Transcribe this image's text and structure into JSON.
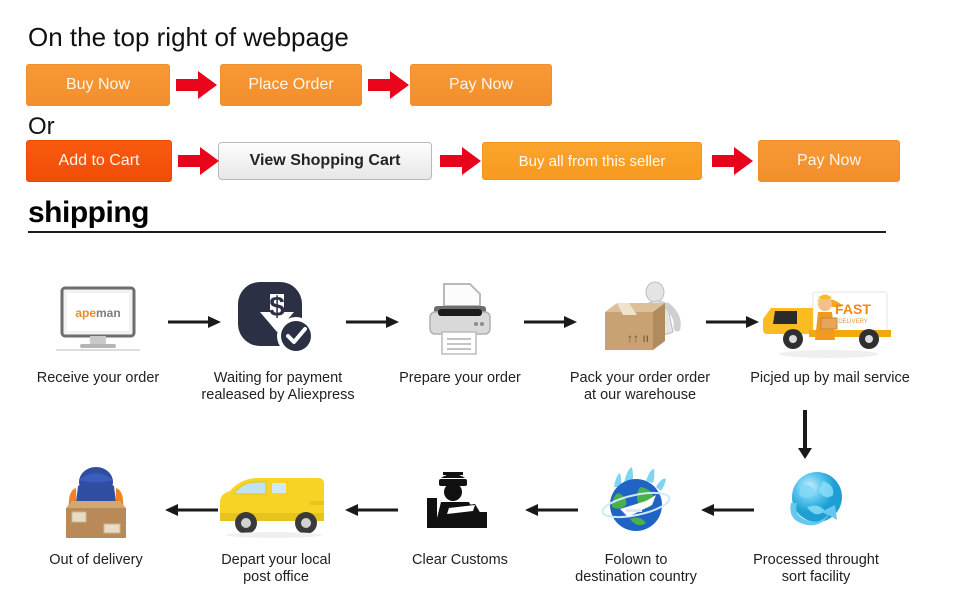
{
  "headings": {
    "top": "On the top right of webpage",
    "or": "Or",
    "shipping": "shipping"
  },
  "colors": {
    "orange": "#f28f2c",
    "deep_orange": "#f04d06",
    "amber": "#f79a21",
    "red_arrow": "#e8041a",
    "grey_button_text": "#242424",
    "rule": "#1b1b1b"
  },
  "flow_top": {
    "buttons": [
      {
        "label": "Buy Now",
        "style": "orange"
      },
      {
        "label": "Place Order",
        "style": "orange"
      },
      {
        "label": "Pay Now",
        "style": "orange"
      }
    ],
    "arrow_icon": "right-arrow-icon"
  },
  "flow_cart": {
    "buttons": [
      {
        "label": "Add to Cart",
        "style": "deep-orange"
      },
      {
        "label": "View Shopping Cart",
        "style": "grey"
      },
      {
        "label": "Buy all from this seller",
        "style": "amber"
      },
      {
        "label": "Pay Now",
        "style": "orange"
      }
    ],
    "arrow_icon": "right-arrow-icon"
  },
  "shipping_flow": {
    "row1": [
      {
        "icon": "monitor-icon",
        "brand": "apeman",
        "label": "Receive your order"
      },
      {
        "icon": "payment-dollar-check-icon",
        "label": "Waiting for payment\nrealeased by Aliexpress"
      },
      {
        "icon": "printer-icon",
        "label": "Prepare your order"
      },
      {
        "icon": "package-worker-icon",
        "label": "Pack your order order\nat our warehouse"
      },
      {
        "icon": "delivery-truck-fast-icon",
        "truck_text": "FAST",
        "truck_subtext": "DELIVERY",
        "label": "Picjed up by mail service"
      }
    ],
    "row2": [
      {
        "icon": "delivery-man-box-icon",
        "label": "Out of delivery"
      },
      {
        "icon": "yellow-van-icon",
        "label": "Depart your local\npost office"
      },
      {
        "icon": "customs-officer-icon",
        "label": "Clear Customs"
      },
      {
        "icon": "globe-airplane-icon",
        "label": "Folown to\ndestination country"
      },
      {
        "icon": "globe-sort-facility-icon",
        "label": "Processed throught\nsort facility"
      }
    ],
    "down_arrow_icon": "down-arrow-icon",
    "left_arrow_icon": "left-arrow-icon",
    "right_arrow_icon": "right-arrow-icon"
  }
}
